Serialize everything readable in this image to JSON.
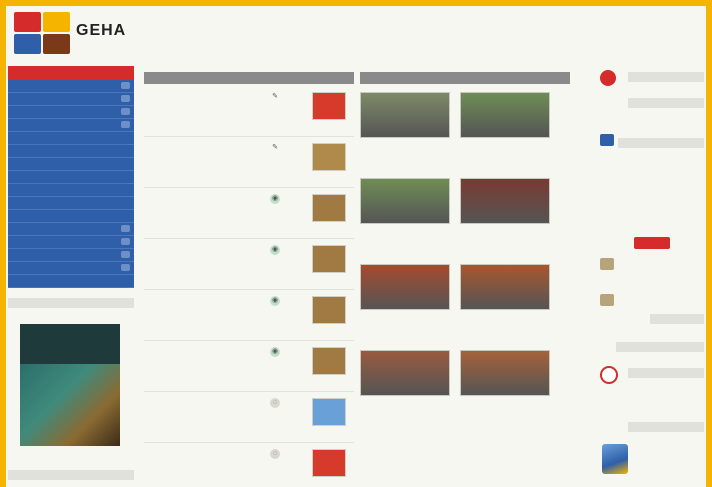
{
  "site": {
    "brand": "GEHA",
    "tagline": "",
    "logo_colors": [
      "#d62b2b",
      "#f5b400",
      "#2f5fa8",
      "#7a3a1a"
    ]
  },
  "left_nav": {
    "header": "",
    "items": [
      {
        "label": "",
        "count": ""
      },
      {
        "label": "",
        "count": ""
      },
      {
        "label": "",
        "count": ""
      },
      {
        "label": "",
        "count": ""
      },
      {
        "label": "",
        "count": ""
      },
      {
        "label": "",
        "count": ""
      },
      {
        "label": "",
        "count": ""
      },
      {
        "label": "",
        "count": ""
      },
      {
        "label": "",
        "count": ""
      },
      {
        "label": "",
        "count": ""
      },
      {
        "label": "",
        "count": ""
      },
      {
        "label": "",
        "count": ""
      },
      {
        "label": "",
        "count": ""
      },
      {
        "label": "",
        "count": ""
      },
      {
        "label": "",
        "count": ""
      },
      {
        "label": "",
        "count": ""
      }
    ]
  },
  "magazine": {
    "section_label": "",
    "cover_title": "",
    "caption": ""
  },
  "news": {
    "header": "",
    "items": [
      {
        "time": "",
        "title": "",
        "meta": "",
        "icon": "pencil-icon",
        "thumb_color": "#d63a2a"
      },
      {
        "time": "",
        "title": "",
        "meta": "",
        "icon": "pencil-icon",
        "thumb_color": "#b08a4a"
      },
      {
        "time": "",
        "title": "",
        "meta": "",
        "icon": "photo-icon",
        "thumb_color": "#a07a42"
      },
      {
        "time": "",
        "title": "",
        "meta": "",
        "icon": "photo-icon",
        "thumb_color": "#a07a42"
      },
      {
        "time": "",
        "title": "",
        "meta": "",
        "icon": "photo-icon",
        "thumb_color": "#a07a42"
      },
      {
        "time": "",
        "title": "",
        "meta": "",
        "icon": "photo-icon",
        "thumb_color": "#a07a42"
      },
      {
        "time": "",
        "title": "",
        "meta": "",
        "icon": "globe-icon",
        "thumb_color": "#6aa0d8"
      },
      {
        "time": "",
        "title": "",
        "meta": "",
        "icon": "globe-icon",
        "thumb_color": "#d63a2a"
      }
    ]
  },
  "photos": {
    "header": "",
    "items": [
      {
        "caption": "",
        "color": "#7d8a68"
      },
      {
        "caption": "",
        "color": "#6f8d55"
      },
      {
        "caption": "",
        "color": "#6f8d55"
      },
      {
        "caption": "",
        "color": "#7a3a32"
      },
      {
        "caption": "",
        "color": "#a64a2e"
      },
      {
        "caption": "",
        "color": "#a8562e"
      },
      {
        "caption": "",
        "color": "#9a5a3e"
      },
      {
        "caption": "",
        "color": "#a5623a"
      }
    ]
  },
  "right": {
    "badge": "",
    "button_label": "",
    "text_lines": [
      "",
      "",
      "",
      "",
      "",
      ""
    ]
  },
  "colors": {
    "frame": "#f5b400",
    "nav_blue": "#2f5fa8",
    "accent_red": "#d62b2b",
    "header_grey": "#8a8a8a"
  }
}
